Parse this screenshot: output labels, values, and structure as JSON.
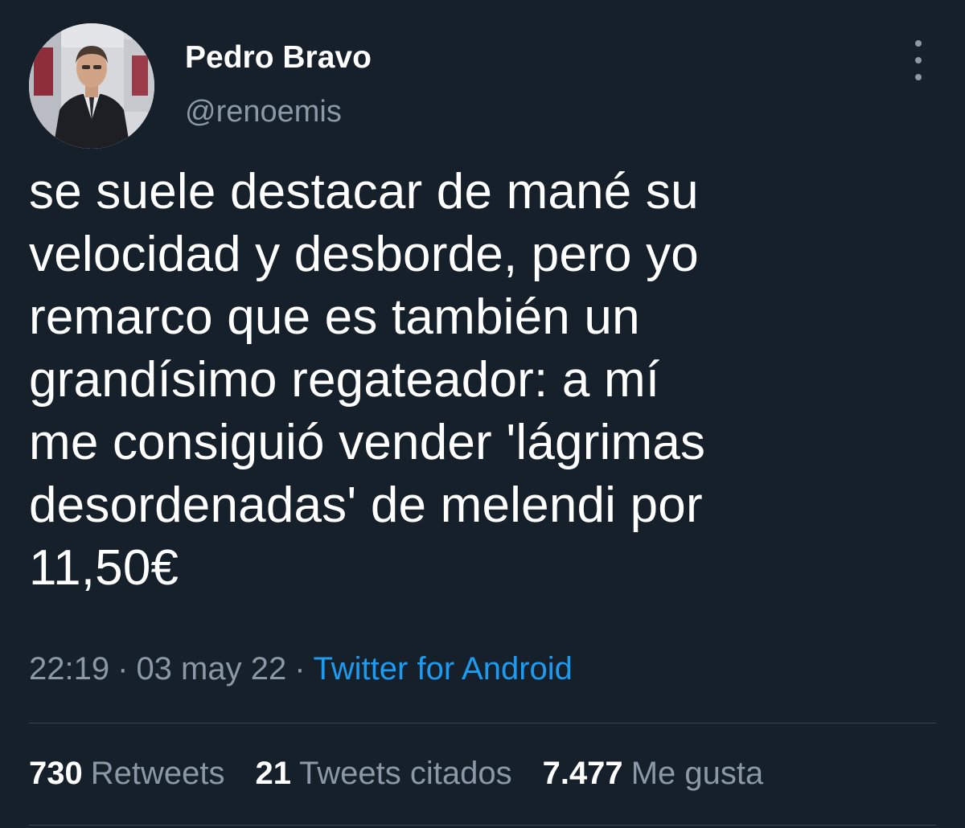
{
  "author": {
    "display_name": "Pedro Bravo",
    "handle": "@renoemis",
    "avatar_icon": "profile-photo"
  },
  "tweet": {
    "lines": [
      "se suele destacar de mané su",
      "velocidad y desborde, pero yo",
      "remarco que es también un",
      "grandísimo regateador: a mí",
      "me consiguió vender 'lágrimas",
      "desordenadas' de melendi por",
      "11,50€"
    ]
  },
  "meta": {
    "time": "22:19",
    "date": "03 may 22",
    "separator": "·",
    "source": "Twitter for Android"
  },
  "stats": {
    "retweets_count": "730",
    "retweets_label": "Retweets",
    "quotes_count": "21",
    "quotes_label": "Tweets citados",
    "likes_count": "7.477",
    "likes_label": "Me gusta"
  },
  "colors": {
    "background": "#15202b",
    "secondary_text": "#8b98a5",
    "link": "#1d9bf0",
    "divider": "#38444d"
  }
}
